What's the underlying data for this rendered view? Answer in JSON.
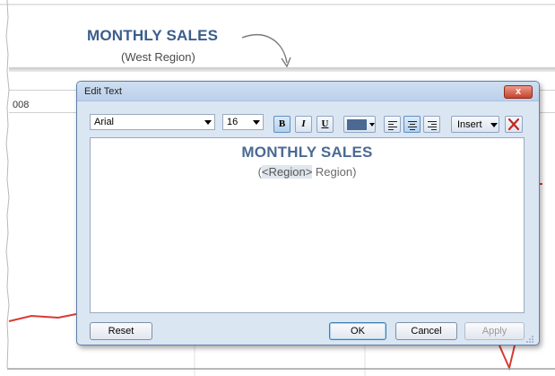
{
  "worksheet": {
    "title": "MONTHLY SALES",
    "subtitle": "(West Region)",
    "year_fragment": "008",
    "line_color": "#d93a33"
  },
  "dialog": {
    "title": "Edit Text",
    "close_label": "x",
    "toolbar": {
      "font": "Arial",
      "size": "16",
      "bold_label": "B",
      "italic_label": "I",
      "underline_label": "U",
      "text_color": "#4a6a94",
      "insert_label": "Insert",
      "active_alignment": "center"
    },
    "editor": {
      "line1": "MONTHLY SALES",
      "line2_prefix": "(",
      "line2_field": "<Region>",
      "line2_suffix": " Region)"
    },
    "buttons": {
      "reset": "Reset",
      "ok": "OK",
      "cancel": "Cancel",
      "apply": "Apply"
    }
  }
}
